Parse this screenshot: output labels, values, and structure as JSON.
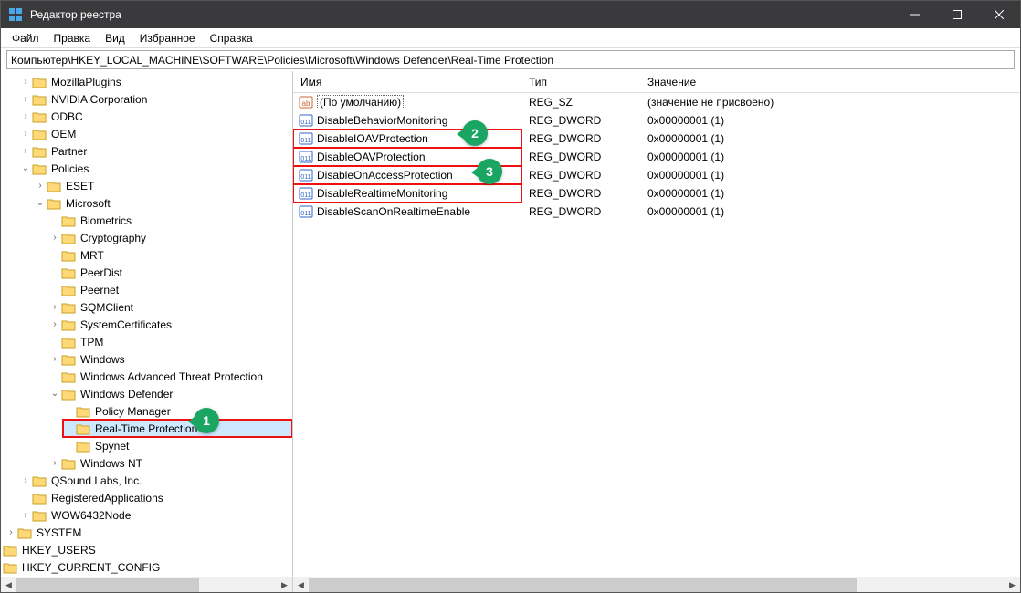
{
  "window": {
    "title": "Редактор реестра"
  },
  "menu": {
    "file": "Файл",
    "edit": "Правка",
    "view": "Вид",
    "favorites": "Избранное",
    "help": "Справка"
  },
  "address": "Компьютер\\HKEY_LOCAL_MACHINE\\SOFTWARE\\Policies\\Microsoft\\Windows Defender\\Real-Time Protection",
  "tree": {
    "mozilla": "MozillaPlugins",
    "nvidia": "NVIDIA Corporation",
    "odbc": "ODBC",
    "oem": "OEM",
    "partner": "Partner",
    "policies": "Policies",
    "eset": "ESET",
    "microsoft": "Microsoft",
    "biometrics": "Biometrics",
    "cryptography": "Cryptography",
    "mrt": "MRT",
    "peerdist": "PeerDist",
    "peernet": "Peernet",
    "sqmclient": "SQMClient",
    "syscerts": "SystemCertificates",
    "tpm": "TPM",
    "windows": "Windows",
    "watp": "Windows Advanced Threat Protection",
    "defender": "Windows Defender",
    "policymanager": "Policy Manager",
    "rtprotection": "Real-Time Protection",
    "spynet": "Spynet",
    "winnt": "Windows NT",
    "qsound": "QSound Labs, Inc.",
    "regapps": "RegisteredApplications",
    "wow64": "WOW6432Node",
    "system": "SYSTEM",
    "hkusers": "HKEY_USERS",
    "hkcc": "HKEY_CURRENT_CONFIG"
  },
  "columns": {
    "name": "Имя",
    "type": "Тип",
    "value": "Значение"
  },
  "values": [
    {
      "name": "(По умолчанию)",
      "type": "REG_SZ",
      "value": "(значение не присвоено)",
      "icon": "str",
      "default": true,
      "hl": false
    },
    {
      "name": "DisableBehaviorMonitoring",
      "type": "REG_DWORD",
      "value": "0x00000001 (1)",
      "icon": "bin",
      "default": false,
      "hl": false
    },
    {
      "name": "DisableIOAVProtection",
      "type": "REG_DWORD",
      "value": "0x00000001 (1)",
      "icon": "bin",
      "default": false,
      "hl": true
    },
    {
      "name": "DisableOAVProtection",
      "type": "REG_DWORD",
      "value": "0x00000001 (1)",
      "icon": "bin",
      "default": false,
      "hl": true
    },
    {
      "name": "DisableOnAccessProtection",
      "type": "REG_DWORD",
      "value": "0x00000001 (1)",
      "icon": "bin",
      "default": false,
      "hl": true
    },
    {
      "name": "DisableRealtimeMonitoring",
      "type": "REG_DWORD",
      "value": "0x00000001 (1)",
      "icon": "bin",
      "default": false,
      "hl": true
    },
    {
      "name": "DisableScanOnRealtimeEnable",
      "type": "REG_DWORD",
      "value": "0x00000001 (1)",
      "icon": "bin",
      "default": false,
      "hl": false
    }
  ],
  "callouts": {
    "c1": "1",
    "c2": "2",
    "c3": "3"
  }
}
